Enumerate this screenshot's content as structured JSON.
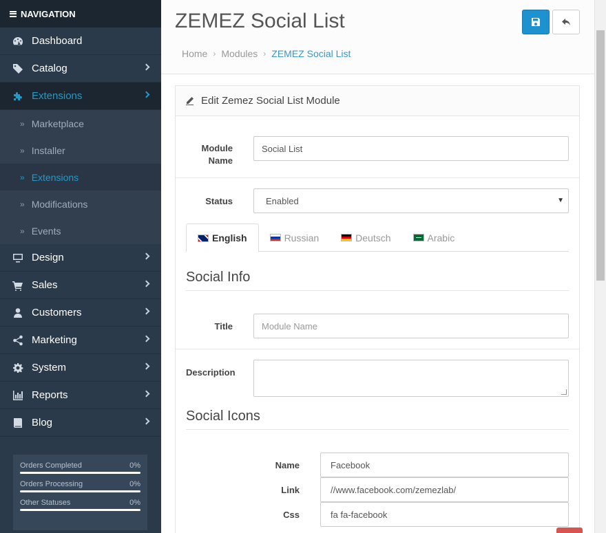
{
  "nav": {
    "header": "NAVIGATION",
    "items": [
      {
        "label": "Dashboard",
        "icon": "dashboard-icon",
        "chevron": false
      },
      {
        "label": "Catalog",
        "icon": "tags-icon",
        "chevron": true
      },
      {
        "label": "Extensions",
        "icon": "puzzle-icon",
        "chevron": true,
        "active": true
      },
      {
        "label": "Design",
        "icon": "monitor-icon",
        "chevron": true
      },
      {
        "label": "Sales",
        "icon": "cart-icon",
        "chevron": true
      },
      {
        "label": "Customers",
        "icon": "user-icon",
        "chevron": true
      },
      {
        "label": "Marketing",
        "icon": "share-icon",
        "chevron": true
      },
      {
        "label": "System",
        "icon": "gear-icon",
        "chevron": true
      },
      {
        "label": "Reports",
        "icon": "bar-chart-icon",
        "chevron": true
      },
      {
        "label": "Blog",
        "icon": "book-icon",
        "chevron": true
      }
    ],
    "submenu": [
      {
        "label": "Marketplace"
      },
      {
        "label": "Installer"
      },
      {
        "label": "Extensions",
        "active": true
      },
      {
        "label": "Modifications"
      },
      {
        "label": "Events"
      }
    ],
    "stats": [
      {
        "label": "Orders Completed",
        "value": "0%",
        "progress": 0
      },
      {
        "label": "Orders Processing",
        "value": "0%",
        "progress": 0
      },
      {
        "label": "Other Statuses",
        "value": "0%",
        "progress": 0
      }
    ]
  },
  "page": {
    "title": "ZEMEZ Social List",
    "breadcrumb": [
      "Home",
      "Modules",
      "ZEMEZ Social List"
    ],
    "save_icon": "save-icon",
    "back_icon": "reply-icon"
  },
  "panel": {
    "heading": "Edit Zemez Social List Module",
    "module_name_label": "Module Name",
    "module_name_value": "Social List",
    "status_label": "Status",
    "status_value": "Enabled",
    "tabs": [
      {
        "label": "English",
        "flag": "flag-en",
        "active": true
      },
      {
        "label": "Russian",
        "flag": "flag-ru"
      },
      {
        "label": "Deutsch",
        "flag": "flag-de"
      },
      {
        "label": "Arabic",
        "flag": "flag-ar"
      }
    ],
    "social_info_title": "Social Info",
    "title_label": "Title",
    "title_placeholder": "Module Name",
    "description_label": "Description",
    "social_icons_title": "Social Icons",
    "name_label": "Name",
    "name_value": "Facebook",
    "link_label": "Link",
    "link_value": "//www.facebook.com/zemezlab/",
    "css_label": "Css",
    "css_value": "fa fa-facebook"
  }
}
